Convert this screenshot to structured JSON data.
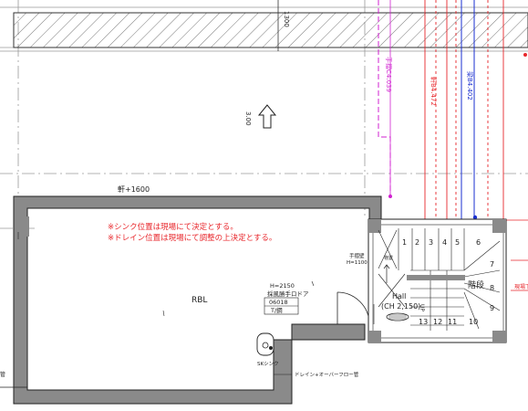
{
  "colors": {
    "wall_fill": "#8a8a8a",
    "line": "#222222",
    "red": "#e8262b",
    "magenta": "#d020d0",
    "blue": "#1a2fd0",
    "gridline": "#9a9a9a"
  },
  "labels": {
    "dim_top": "1300",
    "arrow_dim": "3.00",
    "eave": "軒+1600",
    "note_sink": "※シンク位置は現場にて決定とする。",
    "note_drain": "※ドレイン位置は現場にて調整の上決定とする。",
    "rbl": "RBL",
    "door_h": "H=2150",
    "door_type": "採風勝手ロドア",
    "door_code": "06018",
    "door_mat": "T/鋼",
    "sink": "SKシンク",
    "drain_pipe": "ドレイン+オーバーフロー管",
    "left_tag": "管",
    "right_tag": "現場下",
    "handrail": "手摺壁",
    "handrail_h": "H=1100",
    "storage": "物置",
    "stairs": "階段",
    "hall": "Hall",
    "ceiling": "(CH 2,150)",
    "up": "UP",
    "line_magenta": "手摺C4.039",
    "line_red": "軒B4.472",
    "line_blue": "梁B4.402"
  },
  "stair_numbers": [
    "1",
    "2",
    "3",
    "4",
    "5",
    "6",
    "7",
    "8",
    "9",
    "10",
    "11",
    "12",
    "13"
  ]
}
